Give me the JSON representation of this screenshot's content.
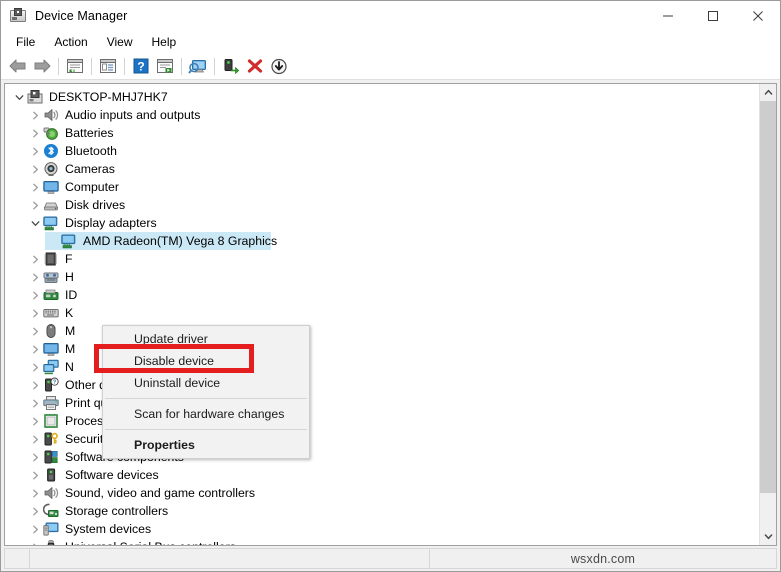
{
  "window": {
    "title": "Device Manager",
    "icon": "device-manager-icon",
    "buttons": {
      "minimize": "minimize-icon",
      "maximize": "maximize-icon",
      "close": "close-icon"
    }
  },
  "menubar": {
    "items": [
      {
        "label": "File"
      },
      {
        "label": "Action"
      },
      {
        "label": "View"
      },
      {
        "label": "Help"
      }
    ]
  },
  "toolbar": {
    "buttons": [
      {
        "name": "back-icon",
        "title": "Back"
      },
      {
        "name": "forward-icon",
        "title": "Forward"
      },
      {
        "name": "show-hide-console-tree-icon",
        "title": "Show/Hide Console Tree"
      },
      {
        "name": "properties-icon",
        "title": "Properties"
      },
      {
        "name": "help-icon",
        "title": "Help"
      },
      {
        "name": "update-driver-icon",
        "title": "Update Driver Software"
      },
      {
        "name": "scan-for-hardware-changes-icon",
        "title": "Scan for hardware changes"
      },
      {
        "name": "enable-device-icon",
        "title": "Enable device"
      },
      {
        "name": "uninstall-device-icon",
        "title": "Uninstall device"
      },
      {
        "name": "disable-device-icon",
        "title": "Disable device"
      }
    ]
  },
  "tree": {
    "root": {
      "label": "DESKTOP-MHJ7HK7",
      "icon": "computer-root-icon",
      "expanded": true
    },
    "items": [
      {
        "label": "Audio inputs and outputs",
        "icon": "speaker-icon",
        "indent": 1,
        "expanded": false
      },
      {
        "label": "Batteries",
        "icon": "battery-icon",
        "indent": 1,
        "expanded": false
      },
      {
        "label": "Bluetooth",
        "icon": "bluetooth-icon",
        "indent": 1,
        "expanded": false
      },
      {
        "label": "Cameras",
        "icon": "camera-icon",
        "indent": 1,
        "expanded": false
      },
      {
        "label": "Computer",
        "icon": "monitor-icon",
        "indent": 1,
        "expanded": false
      },
      {
        "label": "Disk drives",
        "icon": "disk-drive-icon",
        "indent": 1,
        "expanded": false
      },
      {
        "label": "Display adapters",
        "icon": "display-adapter-icon",
        "indent": 1,
        "expanded": true
      },
      {
        "label": "AMD Radeon(TM) Vega 8 Graphics",
        "icon": "display-adapter-icon",
        "indent": 2,
        "selected": true
      },
      {
        "label": "F",
        "icon": "firmware-icon",
        "indent": 1,
        "expanded": false,
        "occluded": true
      },
      {
        "label": "H",
        "icon": "human-interface-icon",
        "indent": 1,
        "expanded": false,
        "occluded": true
      },
      {
        "label": "ID",
        "icon": "ide-controller-icon",
        "indent": 1,
        "expanded": false,
        "occluded": true
      },
      {
        "label": "K",
        "icon": "keyboard-icon",
        "indent": 1,
        "expanded": false,
        "occluded": true
      },
      {
        "label": "M",
        "icon": "mouse-icon",
        "indent": 1,
        "expanded": false,
        "occluded": true
      },
      {
        "label": "M",
        "icon": "monitor-icon",
        "indent": 1,
        "expanded": false,
        "occluded": true
      },
      {
        "label": "N",
        "icon": "network-adapter-icon",
        "indent": 1,
        "expanded": false,
        "occluded": true
      },
      {
        "label": "Other devices",
        "icon": "other-device-icon",
        "indent": 1,
        "expanded": false
      },
      {
        "label": "Print queues",
        "icon": "printer-icon",
        "indent": 1,
        "expanded": false
      },
      {
        "label": "Processors",
        "icon": "processor-icon",
        "indent": 1,
        "expanded": false
      },
      {
        "label": "Security devices",
        "icon": "security-device-icon",
        "indent": 1,
        "expanded": false
      },
      {
        "label": "Software components",
        "icon": "software-component-icon",
        "indent": 1,
        "expanded": false
      },
      {
        "label": "Software devices",
        "icon": "software-device-icon",
        "indent": 1,
        "expanded": false
      },
      {
        "label": "Sound, video and game controllers",
        "icon": "speaker-icon",
        "indent": 1,
        "expanded": false
      },
      {
        "label": "Storage controllers",
        "icon": "storage-controller-icon",
        "indent": 1,
        "expanded": false
      },
      {
        "label": "System devices",
        "icon": "system-device-icon",
        "indent": 1,
        "expanded": false
      },
      {
        "label": "Universal Serial Bus controllers",
        "icon": "usb-icon",
        "indent": 1,
        "expanded": false
      }
    ]
  },
  "context_menu": {
    "items": [
      {
        "label": "Update driver",
        "type": "item"
      },
      {
        "label": "Disable device",
        "type": "item",
        "highlighted": true
      },
      {
        "label": "Uninstall device",
        "type": "item"
      },
      {
        "type": "separator"
      },
      {
        "label": "Scan for hardware changes",
        "type": "item"
      },
      {
        "type": "separator"
      },
      {
        "label": "Properties",
        "type": "item",
        "bold": true
      }
    ]
  },
  "annotation": {
    "highlight_color": "#e41e1e",
    "target": "Disable device"
  },
  "statusbar": {
    "left": "",
    "middle": "",
    "watermark": "wsxdn.com"
  },
  "colors": {
    "selection": "#cbe8f6",
    "window_bg": "#ffffff",
    "chrome_bg": "#f0f0f0",
    "highlight": "#e41e1e"
  }
}
